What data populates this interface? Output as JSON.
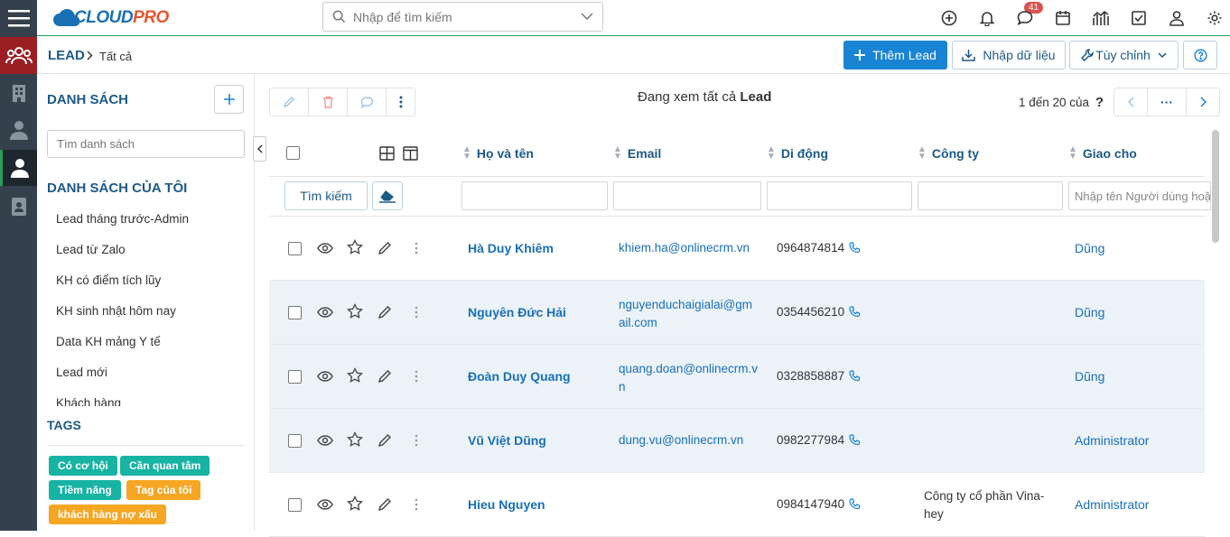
{
  "app": {
    "logo_text_a": "CLOUD",
    "logo_text_b": "PRO",
    "search_placeholder": "Nhập để tìm kiếm",
    "notification_count": "41"
  },
  "colors": {
    "rail": "#34404b",
    "rail_active": "#9b1e22",
    "primary": "#1a84d4",
    "link": "#1a6fb5",
    "tag_teal": "#17b3a3",
    "tag_orange": "#f5a623"
  },
  "breadcrumb": {
    "module": "LEAD",
    "view": "Tất cả"
  },
  "actions": {
    "add_lead": "Thêm Lead",
    "import": "Nhập dữ liệu",
    "customize": "Tùy chỉnh"
  },
  "sidebar": {
    "list_title": "DANH SÁCH",
    "search_placeholder": "Tìm danh sách",
    "my_lists_title": "DANH SÁCH CỦA TÔI",
    "items": [
      "Lead tháng trước-Admin",
      "Lead từ Zalo",
      "KH có điểm tích lũy",
      "KH sinh nhật hôm nay",
      "Data KH mảng Y tế",
      "Lead mới",
      "Khách hàng"
    ],
    "tags_title": "TAGS",
    "tags": [
      {
        "label": "Có cơ hội",
        "color": "teal"
      },
      {
        "label": "Cần quan tâm",
        "color": "teal"
      },
      {
        "label": "Tiềm năng",
        "color": "teal"
      },
      {
        "label": "Tag của tôi",
        "color": "orange"
      },
      {
        "label": "khách hàng nợ xấu",
        "color": "orange"
      }
    ]
  },
  "list": {
    "viewing_prefix": "Đang xem tất cả",
    "viewing_module": "Lead",
    "pagination": "1 đến 20 của",
    "pagination_unknown": "?",
    "more": "···",
    "search_button": "Tìm kiếm",
    "columns": [
      "Họ và tên",
      "Email",
      "Di động",
      "Công ty",
      "Giao cho"
    ],
    "assign_filter_placeholder": "Nhập tên Người dùng hoặc nhóm",
    "rows": [
      {
        "name": "Hà Duy Khiêm",
        "email": "khiem.ha@onlinecrm.vn",
        "phone": "0964874814",
        "company": "",
        "assigned": "Dũng"
      },
      {
        "name": "Nguyên Đức Hải",
        "email": "nguyenduchaigialai@gmail.com",
        "phone": "0354456210",
        "company": "",
        "assigned": "Dũng"
      },
      {
        "name": "Đoàn Duy Quang",
        "email": "quang.doan@onlinecrm.vn",
        "phone": "0328858887",
        "company": "",
        "assigned": "Dũng"
      },
      {
        "name": "Vũ Việt Dũng",
        "email": "dung.vu@onlinecrm.vn",
        "phone": "0982277984",
        "company": "",
        "assigned": "Administrator"
      },
      {
        "name": "Hieu Nguyen",
        "email": "",
        "phone": "0984147940",
        "company": "Công ty cổ phần Vina-hey",
        "assigned": "Administrator"
      }
    ]
  }
}
